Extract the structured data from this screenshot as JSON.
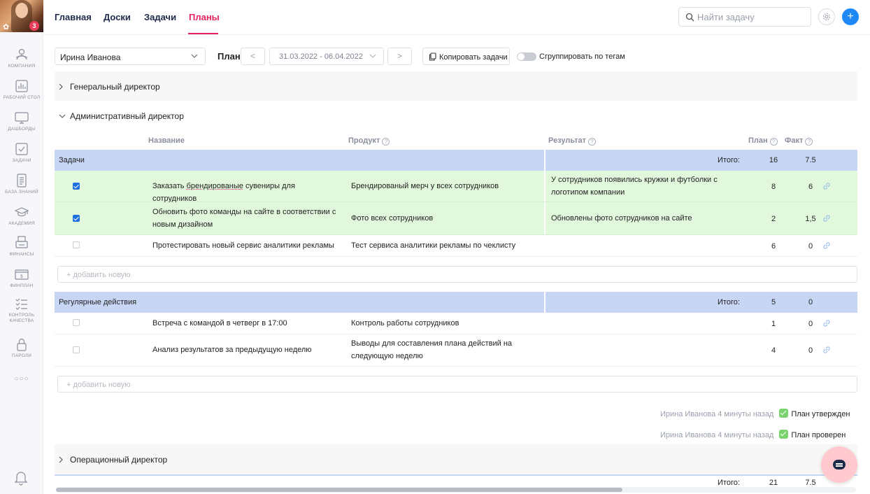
{
  "sidebar": {
    "badge": "3",
    "items": [
      {
        "label": "Компания",
        "icon": "company-icon"
      },
      {
        "label": "Рабочий стол",
        "icon": "desktop-chart-icon"
      },
      {
        "label": "Дашборды",
        "icon": "monitor-icon"
      },
      {
        "label": "Задачи",
        "icon": "checkbox-icon"
      },
      {
        "label": "База знаний",
        "icon": "document-icon"
      },
      {
        "label": "Академия",
        "icon": "graduation-cap-icon"
      },
      {
        "label": "Финансы",
        "icon": "printer-icon"
      },
      {
        "label": "Финплан",
        "icon": "money-icon"
      },
      {
        "label": "Контроль качества",
        "icon": "checklist-icon"
      },
      {
        "label": "Пароли",
        "icon": "lock-icon"
      }
    ],
    "more": "○○○"
  },
  "nav": {
    "links": [
      "Главная",
      "Доски",
      "Задачи",
      "Планы"
    ],
    "active": "Планы"
  },
  "search": {
    "placeholder": "Найти задачу"
  },
  "toolbar": {
    "employee": "Ирина Иванова",
    "plan_label": "План",
    "prev": "<",
    "next": ">",
    "date_range": "31.03.2022 - 06.04.2022",
    "copy_label": "Копировать задачи",
    "group_toggle_label": "Сгруппировать по тегам",
    "group_toggle_on": false
  },
  "groups": {
    "general": "Генеральный директор",
    "admin": "Административный директор",
    "operations": "Операционный директор"
  },
  "columns": {
    "name": "Название",
    "product": "Продукт",
    "result": "Результат",
    "plan": "План",
    "fact": "Факт",
    "help": "?"
  },
  "tasks": {
    "title": "Задачи",
    "total_label": "Итого:",
    "total_plan": "16",
    "total_fact": "7.5",
    "rows": [
      {
        "done": true,
        "name_pre": "Заказать ",
        "name_mark": "брендированые",
        "name_post": " сувениры для сотрудников",
        "product": "Брендированый мерч у всех сотрудников",
        "result": "У сотрудников появились кружки и футболки с логотипом компании",
        "plan": "8",
        "fact": "6"
      },
      {
        "done": true,
        "name_pre": "Обновить фото команды на сайте в соответствии с новым дизайном",
        "name_mark": "",
        "name_post": "",
        "product": "Фото всех сотрудников",
        "result": "Обновлены фото сотрудников на сайте",
        "plan": "2",
        "fact": "1,5"
      },
      {
        "done": false,
        "name_pre": "Протестировать новый сервис аналитики рекламы",
        "name_mark": "",
        "name_post": "",
        "product": "Тест сервиса аналитики рекламы по чеклисту",
        "result": "",
        "plan": "6",
        "fact": "0"
      }
    ]
  },
  "add_new": "+ добавить новую",
  "regular": {
    "title": "Регулярные действия",
    "total_label": "Итого:",
    "total_plan": "5",
    "total_fact": "0",
    "rows": [
      {
        "done": false,
        "name": "Встреча с командой в четверг в 17:00",
        "product": "Контроль работы сотрудников",
        "result": "",
        "plan": "1",
        "fact": "0"
      },
      {
        "done": false,
        "name": "Анализ результатов за предыдущую неделю",
        "product": "Выводы для составления плана действий на следующую неделю",
        "result": "",
        "plan": "4",
        "fact": "0"
      }
    ]
  },
  "approvals": [
    {
      "who": "Ирина Иванова 4 минуты назад",
      "status": "План утвержден"
    },
    {
      "who": "Ирина Иванова 4 минуты назад",
      "status": "План проверен"
    }
  ],
  "bottom_total": {
    "label": "Итого:",
    "plan": "21",
    "fact": "7.5"
  },
  "colors": {
    "accent": "#e5245f",
    "primary": "#1e88f5",
    "section": "#c6d6f4",
    "done_row": "#e2f8dd",
    "approve": "#7bd36f"
  }
}
